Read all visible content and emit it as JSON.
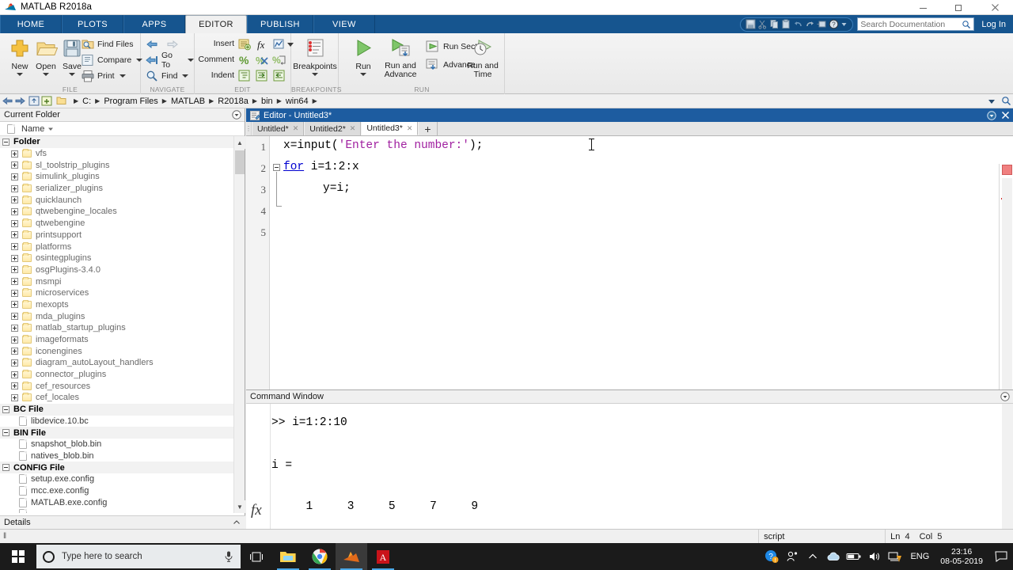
{
  "window": {
    "title": "MATLAB R2018a",
    "logo_icon": "matlab-logo-icon",
    "minimize_label": "—",
    "maximize_label": "❐",
    "close_label": "✕"
  },
  "ribbon": {
    "tabs": [
      {
        "label": "HOME",
        "active": false
      },
      {
        "label": "PLOTS",
        "active": false
      },
      {
        "label": "APPS",
        "active": false
      },
      {
        "label": "EDITOR",
        "active": true
      },
      {
        "label": "PUBLISH",
        "active": false
      },
      {
        "label": "VIEW",
        "active": false
      }
    ],
    "quick_access": [
      "save-icon",
      "cut-icon",
      "copy-icon",
      "paste-icon",
      "undo-icon",
      "redo-icon",
      "simulink-icon",
      "help-icon",
      "chevron-down-icon"
    ],
    "search_documentation": {
      "placeholder": "Search Documentation",
      "value": "",
      "icon": "search-icon"
    },
    "login_label": "Log In",
    "groups": [
      {
        "name": "FILE",
        "label": "FILE",
        "big_buttons": [
          {
            "label": "New",
            "icon": "new-file-icon",
            "has_caret": true
          },
          {
            "label": "Open",
            "icon": "open-folder-icon",
            "has_caret": true
          },
          {
            "label": "Save",
            "icon": "save-disk-icon",
            "has_caret": true
          }
        ],
        "small_buttons": [
          {
            "label": "Find Files",
            "icon": "find-files-icon",
            "has_caret": false
          },
          {
            "label": "Compare",
            "icon": "compare-icon",
            "has_caret": true
          },
          {
            "label": "Print",
            "icon": "print-icon",
            "has_caret": true
          }
        ]
      },
      {
        "name": "NAVIGATE",
        "label": "NAVIGATE",
        "small_buttons": [
          {
            "label": "",
            "icon": "back-arrow-icon",
            "has_caret": false
          },
          {
            "label": "",
            "icon": "forward-arrow-icon",
            "has_caret": false
          },
          {
            "label": "Go To",
            "icon": "go-to-icon",
            "has_caret": true
          },
          {
            "label": "Find",
            "icon": "find-icon",
            "has_caret": true
          }
        ]
      },
      {
        "name": "EDIT",
        "label": "EDIT",
        "rows": [
          {
            "label": "Insert",
            "icons": [
              "insert-section-icon",
              "insert-function-icon",
              "insert-plot-icon",
              "chevron-down-icon"
            ]
          },
          {
            "label": "Comment",
            "icons": [
              "comment-percent-icon",
              "uncomment-icon",
              "wrap-comment-icon"
            ]
          },
          {
            "label": "Indent",
            "icons": [
              "smart-indent-icon",
              "indent-right-icon",
              "indent-left-icon"
            ]
          }
        ]
      },
      {
        "name": "BREAKPOINTS",
        "label": "BREAKPOINTS",
        "big_buttons": [
          {
            "label": "Breakpoints",
            "icon": "breakpoints-icon",
            "has_caret": true
          }
        ]
      },
      {
        "name": "RUN",
        "label": "RUN",
        "big_buttons": [
          {
            "label": "Run",
            "icon": "run-play-icon",
            "has_caret": true
          },
          {
            "label": "Run and\nAdvance",
            "icon": "run-advance-icon",
            "has_caret": false
          },
          {
            "label": "Run and\nTime",
            "icon": "run-time-icon",
            "has_caret": false
          }
        ],
        "small_buttons": [
          {
            "label": "Run Section",
            "icon": "run-section-icon",
            "has_caret": false
          },
          {
            "label": "Advance",
            "icon": "advance-icon",
            "has_caret": false
          }
        ]
      }
    ]
  },
  "address_bar": {
    "back_icon": "back-arrow-icon",
    "forward_icon": "forward-arrow-icon",
    "up_icon": "up-folder-icon",
    "browse_icon": "browse-folder-icon",
    "folder_icon": "folder-icon",
    "crumbs": [
      "C:",
      "Program Files",
      "MATLAB",
      "R2018a",
      "bin",
      "win64"
    ],
    "dropdown_icon": "chevron-down-icon",
    "search_icon": "search-icon"
  },
  "current_folder": {
    "panel_title": "Current Folder",
    "panel_menu_icon": "panel-options-icon",
    "column_header": "Name",
    "column_sort_icon": "sort-descending-icon",
    "header_file_icon": "file-icon",
    "details_label": "Details",
    "details_chevron": "chevron-up-icon",
    "groups": [
      {
        "label": "Folder",
        "items": [
          "vfs",
          "sl_toolstrip_plugins",
          "simulink_plugins",
          "serializer_plugins",
          "quicklaunch",
          "qtwebengine_locales",
          "qtwebengine",
          "printsupport",
          "platforms",
          "osintegplugins",
          "osgPlugins-3.4.0",
          "msmpi",
          "microservices",
          "mexopts",
          "mda_plugins",
          "matlab_startup_plugins",
          "imageformats",
          "iconengines",
          "diagram_autoLayout_handlers",
          "connector_plugins",
          "cef_resources",
          "cef_locales"
        ],
        "type": "folder"
      },
      {
        "label": "BC File",
        "items": [
          "libdevice.10.bc"
        ],
        "type": "file"
      },
      {
        "label": "BIN File",
        "items": [
          "snapshot_blob.bin",
          "natives_blob.bin"
        ],
        "type": "file"
      },
      {
        "label": "CONFIG File",
        "items": [
          "setup.exe.config",
          "mcc.exe.config",
          "MATLAB.exe.config"
        ],
        "type": "file"
      }
    ]
  },
  "editor": {
    "title": "Editor - Untitled3*",
    "title_icon": "editor-icon",
    "dock_icon": "dock-options-icon",
    "close_icon": "close-icon",
    "tabs": [
      {
        "label": "Untitled*",
        "active": false,
        "close_icon": "close-icon"
      },
      {
        "label": "Untitled2*",
        "active": false,
        "close_icon": "close-icon"
      },
      {
        "label": "Untitled3*",
        "active": true,
        "close_icon": "close-icon"
      }
    ],
    "new_tab_label": "+",
    "line_numbers": [
      "1",
      "2",
      "3",
      "4",
      "5"
    ],
    "code_lines": [
      {
        "num": "1",
        "indent": 0,
        "segments": [
          {
            "text": "x=input(",
            "style": "plain"
          },
          {
            "text": "'Enter the number:'",
            "style": "string"
          },
          {
            "text": ");",
            "style": "plain"
          }
        ]
      },
      {
        "num": "2",
        "indent": 0,
        "segments": [
          {
            "text": "for",
            "style": "keyword"
          },
          {
            "text": " i=1:2:x",
            "style": "plain"
          }
        ]
      },
      {
        "num": "3",
        "indent": 1,
        "segments": [
          {
            "text": "y=i;",
            "style": "plain"
          }
        ]
      },
      {
        "num": "4",
        "indent": 0,
        "segments": []
      },
      {
        "num": "5",
        "indent": 0,
        "segments": []
      }
    ]
  },
  "command_window": {
    "title": "Command Window",
    "menu_icon": "panel-options-icon",
    "fx_label": "fx",
    "lines": [
      ">> i=1:2:10",
      "",
      "i =",
      "",
      "     1     3     5     7     9"
    ]
  },
  "status_bar": {
    "left_indicator": "‖",
    "file_type": "script",
    "ln_label": "Ln",
    "ln_value": "4",
    "col_label": "Col",
    "col_value": "5"
  },
  "taskbar": {
    "start_icon": "windows-start-icon",
    "search_placeholder": "Type here to search",
    "search_circle_icon": "cortana-circle-icon",
    "mic_icon": "microphone-icon",
    "task_view_icon": "task-view-icon",
    "apps": [
      {
        "name": "file-explorer-icon",
        "open": true
      },
      {
        "name": "google-chrome-icon",
        "open": true
      },
      {
        "name": "matlab-icon",
        "open": true,
        "active": true
      },
      {
        "name": "adobe-reader-icon",
        "open": true
      }
    ],
    "tray": [
      "help-update-icon",
      "people-icon",
      "show-hidden-icons-icon",
      "onedrive-icon",
      "battery-icon",
      "volume-icon",
      "network-warning-icon"
    ],
    "language": "ENG",
    "time": "23:16",
    "date": "08-05-2019",
    "action_center_icon": "action-center-icon"
  },
  "colors": {
    "ribbon_blue": "#16558f",
    "editor_title_blue": "#1d5ca0",
    "string_purple": "#a020a0",
    "keyword_blue": "#0000d0",
    "taskbar_dark": "#1b1b1b"
  }
}
